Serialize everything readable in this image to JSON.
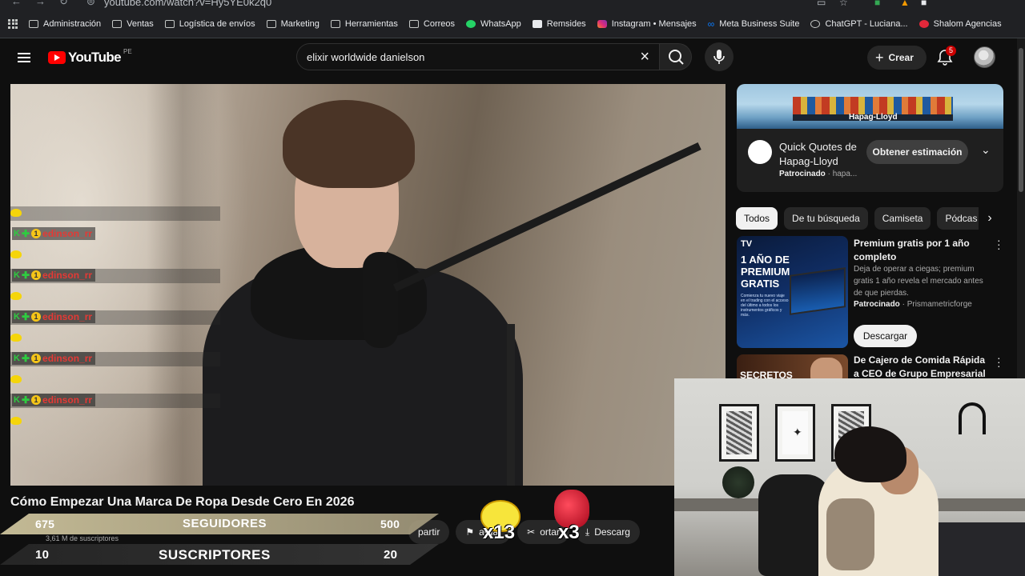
{
  "browser": {
    "url": "youtube.com/watch?v=Hy5YE0k2q0",
    "bookmarks": [
      {
        "label": "Administración",
        "icon": "folder-icon"
      },
      {
        "label": "Ventas",
        "icon": "folder-icon"
      },
      {
        "label": "Logística de envíos",
        "icon": "folder-icon"
      },
      {
        "label": "Marketing",
        "icon": "folder-icon"
      },
      {
        "label": "Herramientas",
        "icon": "folder-icon"
      },
      {
        "label": "Correos",
        "icon": "folder-icon"
      },
      {
        "label": "WhatsApp",
        "icon": "whatsapp-icon"
      },
      {
        "label": "Remsides",
        "icon": "sheet-icon"
      },
      {
        "label": "Instagram • Mensajes",
        "icon": "instagram-icon"
      },
      {
        "label": "Meta Business Suite",
        "icon": "meta-icon"
      },
      {
        "label": "ChatGPT - Luciana...",
        "icon": "chatgpt-icon"
      },
      {
        "label": "Shalom Agencias",
        "icon": "shalom-icon"
      }
    ]
  },
  "header": {
    "logo_text": "YouTube",
    "country_code": "PE",
    "search_value": "elixir worldwide danielson",
    "create_label": "Crear",
    "notification_count": "5",
    "colors": {
      "logo_red": "#ff0000",
      "badge_red": "#cc0000",
      "bg": "#0f0f0f"
    }
  },
  "chat": {
    "messages": [
      {
        "user": "edinson_rr"
      },
      {
        "user": "edinson_rr"
      },
      {
        "user": "edinson_rr"
      },
      {
        "user": "edinson_rr"
      },
      {
        "user": "edinson_rr"
      }
    ],
    "badges": {
      "k": "K",
      "plus": "✚",
      "one": "1"
    }
  },
  "video": {
    "title": "Cómo Empezar Una Marca De Ropa Desde Cero En 2026",
    "subscribers_small": "3,61 M de suscriptores"
  },
  "goals": {
    "followers": {
      "current": "675",
      "label": "SEGUIDORES",
      "target": "500"
    },
    "subscribers": {
      "current": "10",
      "label": "SUSCRIPTORES",
      "target": "20"
    }
  },
  "actions": {
    "share_label": "partir",
    "save_label": "ardar",
    "clip_label": "ortar",
    "download_label": "Descarg",
    "multiplier_1": "x13",
    "multiplier_2": "x3"
  },
  "ad": {
    "brand_banner": "Hapag-Lloyd",
    "title": "Quick Quotes de Hapag-Lloyd",
    "sponsored_label": "Patrocinado",
    "domain": "hapa...",
    "cta": "Obtener estimación"
  },
  "chips": [
    "Todos",
    "De tu búsqueda",
    "Camiseta",
    "Pódcas"
  ],
  "promo": {
    "thumb_logo": "TV",
    "thumb_big": "1 AÑO DE PREMIUM GRATIS",
    "thumb_small": "Comienza tu nuevo viaje en el trading con el acceso del último a todos los instrumentos gráficos y más.",
    "title": "Premium gratis por 1 año completo",
    "desc": "Deja de operar a ciegas; premium gratis 1 año revela el mercado antes de que pierdas.",
    "sponsored_label": "Patrocinado",
    "channel": "Prismametricforge",
    "cta": "Descargar"
  },
  "next_video": {
    "thumb_text": "SECRETOS",
    "title": "De Cajero de Comida Rápida a CEO de Grupo Empresarial"
  }
}
